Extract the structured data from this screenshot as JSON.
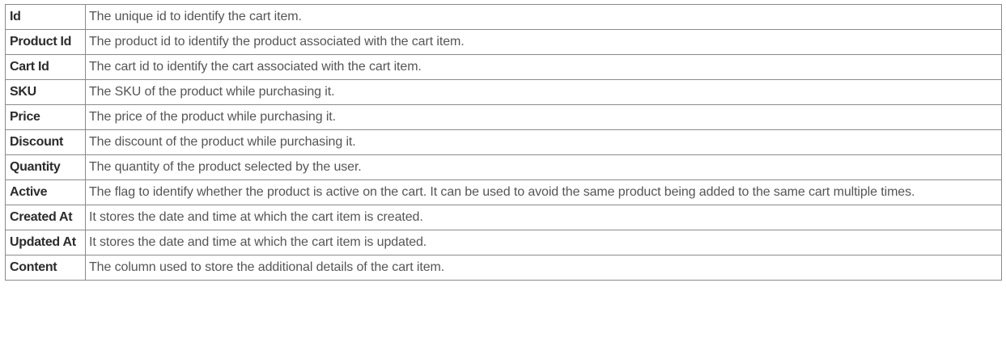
{
  "table": {
    "rows": [
      {
        "field": "Id",
        "description": "The unique id to identify the cart item."
      },
      {
        "field": "Product Id",
        "description": "The product id to identify the product associated with the cart item."
      },
      {
        "field": "Cart Id",
        "description": "The cart id to identify the cart associated with the cart item."
      },
      {
        "field": "SKU",
        "description": "The SKU of the product while purchasing it."
      },
      {
        "field": "Price",
        "description": "The price of the product while purchasing it."
      },
      {
        "field": "Discount",
        "description": "The discount of the product while purchasing it."
      },
      {
        "field": "Quantity",
        "description": "The quantity of the product selected by the user."
      },
      {
        "field": "Active",
        "description": "The flag to identify whether the product is active on the cart. It can be used to avoid the same product being added to the same cart multiple times."
      },
      {
        "field": "Created At",
        "description": "It stores the date and time at which the cart item is created."
      },
      {
        "field": "Updated At",
        "description": "It stores the date and time at which the cart item is updated."
      },
      {
        "field": "Content",
        "description": "The column used to store the additional details of the cart item."
      }
    ]
  },
  "colors": {
    "border": "#8a8a8a",
    "field_text": "#2b2b2b",
    "description_text": "#555555",
    "background": "#ffffff"
  }
}
